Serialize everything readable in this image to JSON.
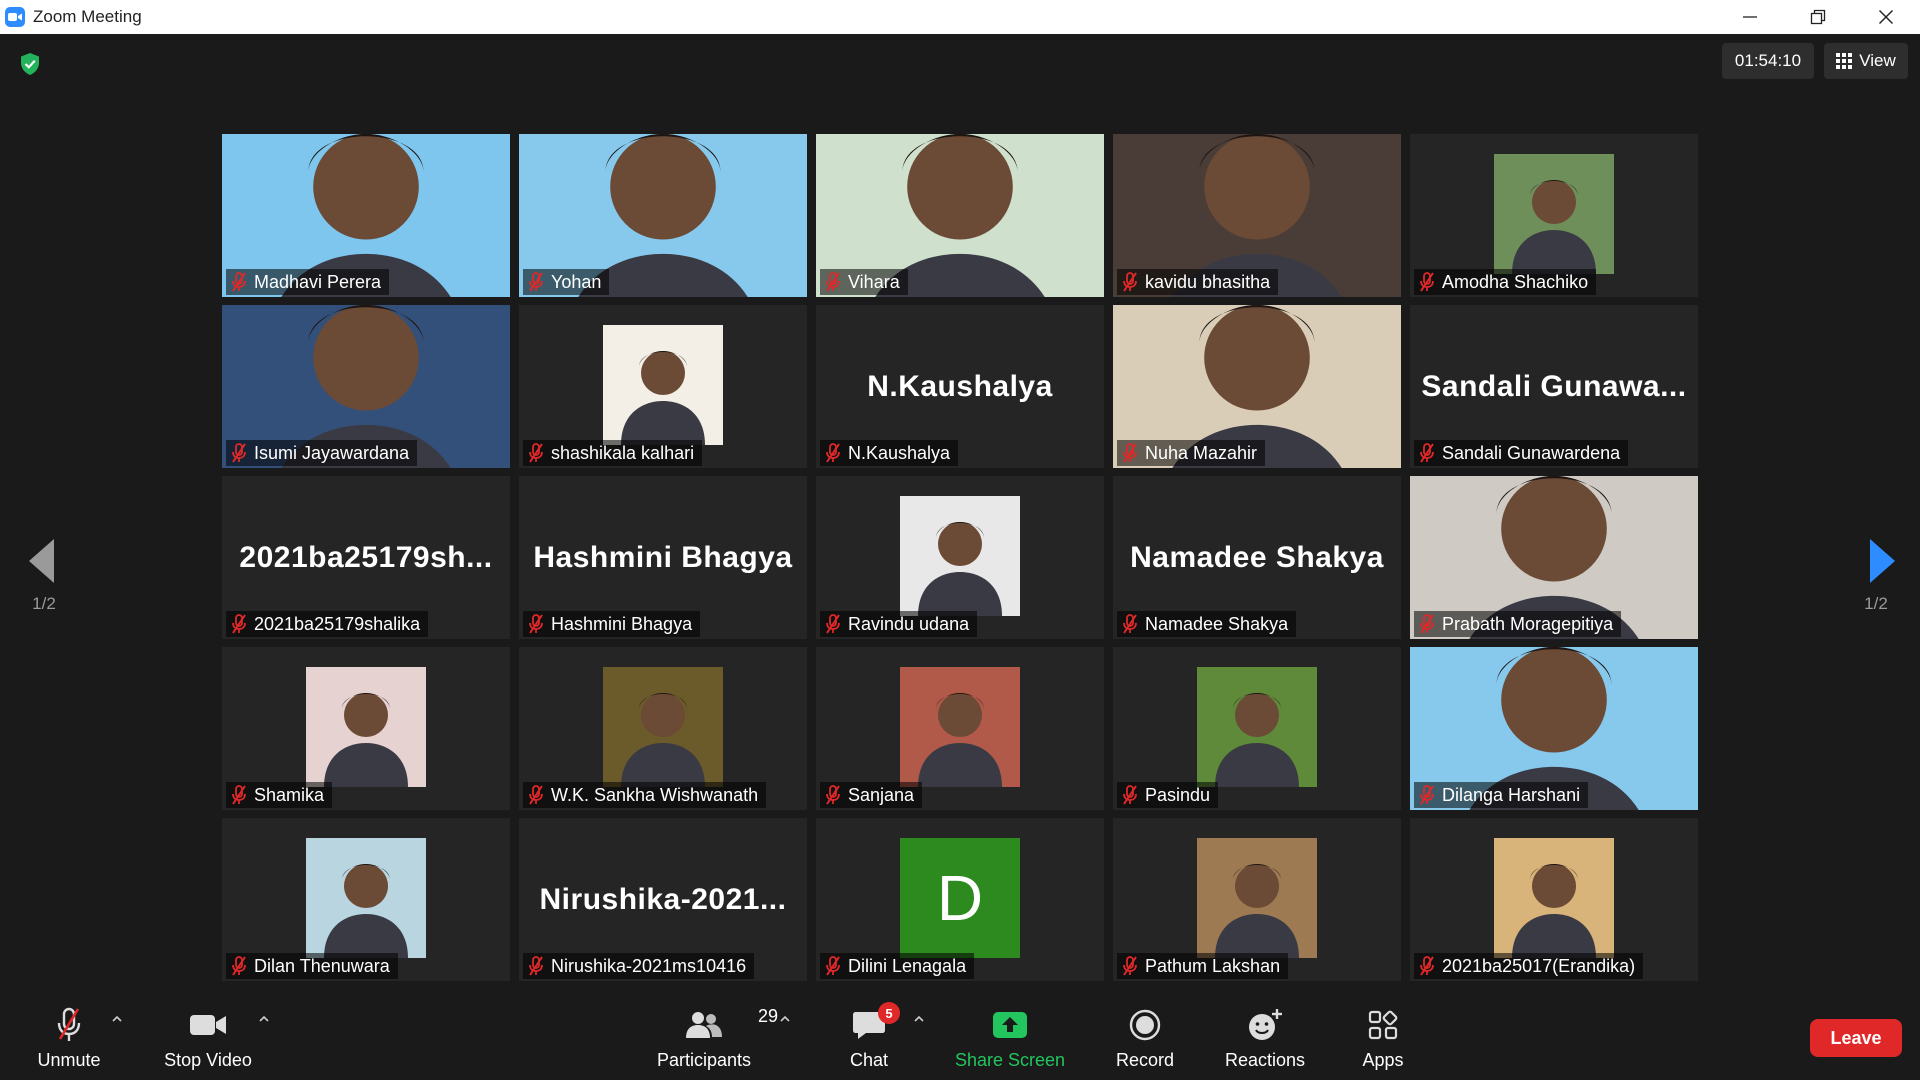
{
  "window": {
    "title": "Zoom Meeting"
  },
  "meeting": {
    "timer": "01:54:10",
    "view_label": "View",
    "page_indicator_left": "1/2",
    "page_indicator_right": "1/2"
  },
  "participants": [
    {
      "name": "Madhavi Perera",
      "kind": "video",
      "bg": "#7ec6ee"
    },
    {
      "name": "Yohan",
      "kind": "video",
      "bg": "#86c9ec"
    },
    {
      "name": "Vihara",
      "kind": "video",
      "bg": "#cfe0cc",
      "active": true
    },
    {
      "name": "kavidu bhasitha",
      "kind": "video",
      "bg": "#4a3c36"
    },
    {
      "name": "Amodha Shachiko",
      "kind": "picture",
      "bg": "#6f8f5a"
    },
    {
      "name": "Isumi Jayawardana",
      "kind": "video",
      "bg": "#33507a"
    },
    {
      "name": "shashikala kalhari",
      "kind": "picture",
      "bg": "#f4efe6"
    },
    {
      "name": "N.Kaushalya",
      "kind": "name",
      "big": "N.Kaushalya"
    },
    {
      "name": "Nuha Mazahir",
      "kind": "video",
      "bg": "#d9cdb8"
    },
    {
      "name": "Sandali Gunawardena",
      "kind": "name",
      "big": "Sandali  Gunawa..."
    },
    {
      "name": "2021ba25179shalika",
      "kind": "name",
      "big": "2021ba25179sh..."
    },
    {
      "name": "Hashmini Bhagya",
      "kind": "name",
      "big": "Hashmini Bhagya"
    },
    {
      "name": "Ravindu udana",
      "kind": "picture",
      "bg": "#e8e8e8"
    },
    {
      "name": "Namadee Shakya",
      "kind": "name",
      "big": "Namadee Shakya"
    },
    {
      "name": "Prabath Moragepitiya",
      "kind": "video",
      "bg": "#cfcac4"
    },
    {
      "name": "Shamika",
      "kind": "picture",
      "bg": "#e7d2d2"
    },
    {
      "name": "W.K. Sankha Wishwanath",
      "kind": "picture",
      "bg": "#6b5a2a"
    },
    {
      "name": "Sanjana",
      "kind": "picture",
      "bg": "#b25a4a"
    },
    {
      "name": "Pasindu",
      "kind": "picture",
      "bg": "#5f8a3a"
    },
    {
      "name": "Dilanga Harshani",
      "kind": "video",
      "bg": "#86c9ec"
    },
    {
      "name": "Dilan Thenuwara",
      "kind": "picture",
      "bg": "#b9d6e0"
    },
    {
      "name": "Nirushika-2021ms10416",
      "kind": "name",
      "big": "Nirushika-2021..."
    },
    {
      "name": "Dilini Lenagala",
      "kind": "avatar",
      "letter": "D"
    },
    {
      "name": "Pathum Lakshan",
      "kind": "picture",
      "bg": "#9d7a52"
    },
    {
      "name": "2021ba25017(Erandika)",
      "kind": "picture",
      "bg": "#d8b47a"
    }
  ],
  "toolbar": {
    "unmute_label": "Unmute",
    "stop_video_label": "Stop Video",
    "participants_label": "Participants",
    "participants_count": "29",
    "chat_label": "Chat",
    "chat_badge": "5",
    "share_screen_label": "Share Screen",
    "record_label": "Record",
    "reactions_label": "Reactions",
    "apps_label": "Apps",
    "leave_label": "Leave"
  },
  "colors": {
    "share_green": "#22c55e",
    "leave_red": "#e02828",
    "active_speaker": "#d6f23c",
    "mute_red": "#e02828"
  }
}
